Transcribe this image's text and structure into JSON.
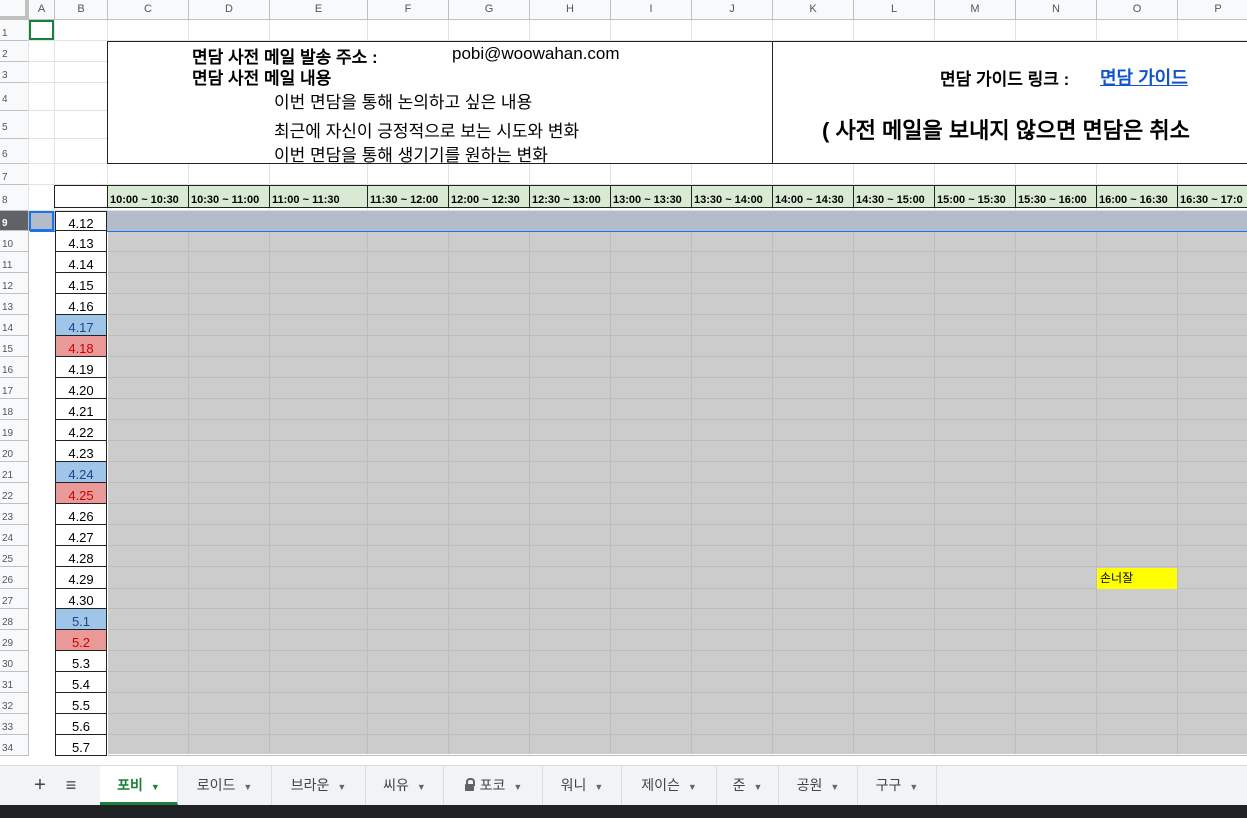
{
  "columns": [
    "A",
    "B",
    "C",
    "D",
    "E",
    "F",
    "G",
    "H",
    "I",
    "J",
    "K",
    "L",
    "M",
    "N",
    "O",
    "P"
  ],
  "rows": [
    "1",
    "2",
    "3",
    "4",
    "5",
    "6",
    "7",
    "8",
    "9",
    "10",
    "11",
    "12",
    "13",
    "14",
    "15",
    "16",
    "17",
    "18",
    "19",
    "20",
    "21",
    "22",
    "23",
    "24",
    "25",
    "26",
    "27",
    "28",
    "29",
    "30",
    "31",
    "32",
    "33",
    "34"
  ],
  "info": {
    "email_label": "면담 사전 메일 발송 주소 :",
    "email_value": "pobi@woowahan.com",
    "content_label": "면담 사전 메일 내용",
    "content_lines": [
      "이번 면담을 통해 논의하고 싶은 내용",
      "최근에 자신이 긍정적으로 보는 시도와 변화",
      "이번 면담을 통해 생기기를 원하는 변화"
    ],
    "guide_label": "면담 가이드 링크 :",
    "guide_link": "면담 가이드",
    "cancel_notice": "( 사전 메일을 보내지 않으면 면담은 취소"
  },
  "time_slots": [
    "10:00 ~ 10:30",
    "10:30 ~ 11:00",
    "11:00 ~ 11:30",
    "11:30 ~ 12:00",
    "12:00 ~ 12:30",
    "12:30 ~ 13:00",
    "13:00 ~ 13:30",
    "13:30 ~ 14:00",
    "14:00 ~ 14:30",
    "14:30 ~ 15:00",
    "15:00 ~ 15:30",
    "15:30 ~ 16:00",
    "16:00 ~ 16:30",
    "16:30 ~ 17:0"
  ],
  "dates": [
    "4.12",
    "4.13",
    "4.14",
    "4.15",
    "4.16",
    "4.17",
    "4.18",
    "4.19",
    "4.20",
    "4.21",
    "4.22",
    "4.23",
    "4.24",
    "4.25",
    "4.26",
    "4.27",
    "4.28",
    "4.29",
    "4.30",
    "5.1",
    "5.2",
    "5.3",
    "5.4",
    "5.5",
    "5.6",
    "5.7"
  ],
  "date_highlights": {
    "blue": [
      "4.17",
      "4.24",
      "5.1"
    ],
    "red": [
      "4.18",
      "4.25",
      "5.2"
    ]
  },
  "booking": {
    "label": "손너잘",
    "date": "4.29",
    "slot": "16:00 ~ 16:30",
    "color": "#ffff00"
  },
  "tabs": {
    "add_label": "+",
    "list_label": "≡",
    "items": [
      "포비",
      "로이드",
      "브라운",
      "씨유",
      "포코",
      "워니",
      "제이슨",
      "준",
      "공원",
      "구구"
    ],
    "active": "포비",
    "locked": "포코"
  },
  "colors": {
    "time_header": "#d9ead3",
    "weekend_blue": "#9fc5e8",
    "weekend_red": "#ea9999",
    "empty_slot": "#cccccc",
    "active_tab": "#188038"
  }
}
